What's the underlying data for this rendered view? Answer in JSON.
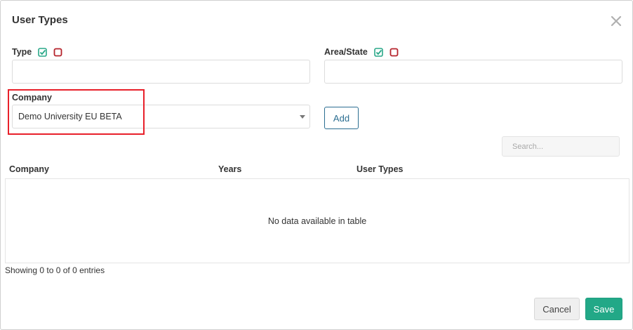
{
  "modal": {
    "title": "User Types"
  },
  "form": {
    "type_label": "Type",
    "type_value": "",
    "area_label": "Area/State",
    "area_value": "",
    "company_label": "Company",
    "company_selected": "Demo University EU BETA",
    "add_label": "Add"
  },
  "table": {
    "search_placeholder": "Search...",
    "columns": [
      "Company",
      "Years",
      "User Types"
    ],
    "empty_message": "No data available in table",
    "info": "Showing 0 to 0 of 0 entries"
  },
  "footer": {
    "cancel_label": "Cancel",
    "save_label": "Save"
  },
  "colors": {
    "check_green": "#2aa889",
    "uncheck_red": "#b5232b",
    "highlight_red": "#e8202a",
    "accent_blue": "#2b6e91",
    "save_green": "#22a887"
  },
  "icons": {
    "close": "close-icon",
    "check_all": "check-square-icon",
    "uncheck_all": "empty-square-icon",
    "dropdown": "chevron-down-icon"
  }
}
